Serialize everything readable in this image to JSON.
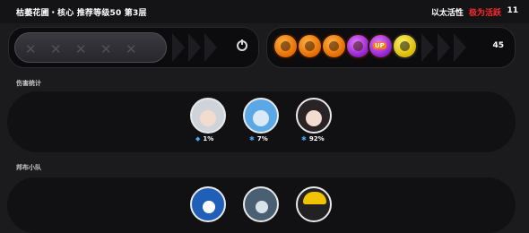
{
  "header": {
    "title": "枯萎花圃・核心 推荐等级50 第3层",
    "ether_label": "以太活性",
    "ether_status": "极为活跃",
    "ether_value": "11"
  },
  "loadout": {
    "empty_slot_marks": [
      "✕",
      "✕",
      "✕",
      "✕",
      "✕"
    ],
    "power_icon": "power-icon",
    "coins": [
      {
        "name": "orange-coin-1",
        "color": "#f28b12"
      },
      {
        "name": "orange-coin-2",
        "color": "#f28b12"
      },
      {
        "name": "orange-coin-3",
        "color": "#f28b12"
      },
      {
        "name": "purple-coin-1",
        "color": "#b640e6"
      },
      {
        "name": "purple-up-coin",
        "color": "#b640e6",
        "label": "UP"
      },
      {
        "name": "yellow-coin",
        "color": "#f2d82a"
      }
    ],
    "coin_count": "45"
  },
  "damage_stats": {
    "label": "伤害统计",
    "agents": [
      {
        "avatar": "white-hair-agent",
        "icon": "ether-icon",
        "value": "1%"
      },
      {
        "avatar": "blue-shark-agent",
        "icon": "ether-icon",
        "value": "7%"
      },
      {
        "avatar": "black-hair-agent",
        "icon": "ether-icon",
        "value": "92%"
      }
    ]
  },
  "bangboo": {
    "label": "邦布小队",
    "members": [
      {
        "avatar": "penguin-bangboo"
      },
      {
        "avatar": "shark-bangboo"
      },
      {
        "avatar": "hardhat-bangboo"
      }
    ]
  },
  "colors": {
    "accent_red": "#ff2a2a",
    "stat_blue": "#3fa9ff"
  }
}
